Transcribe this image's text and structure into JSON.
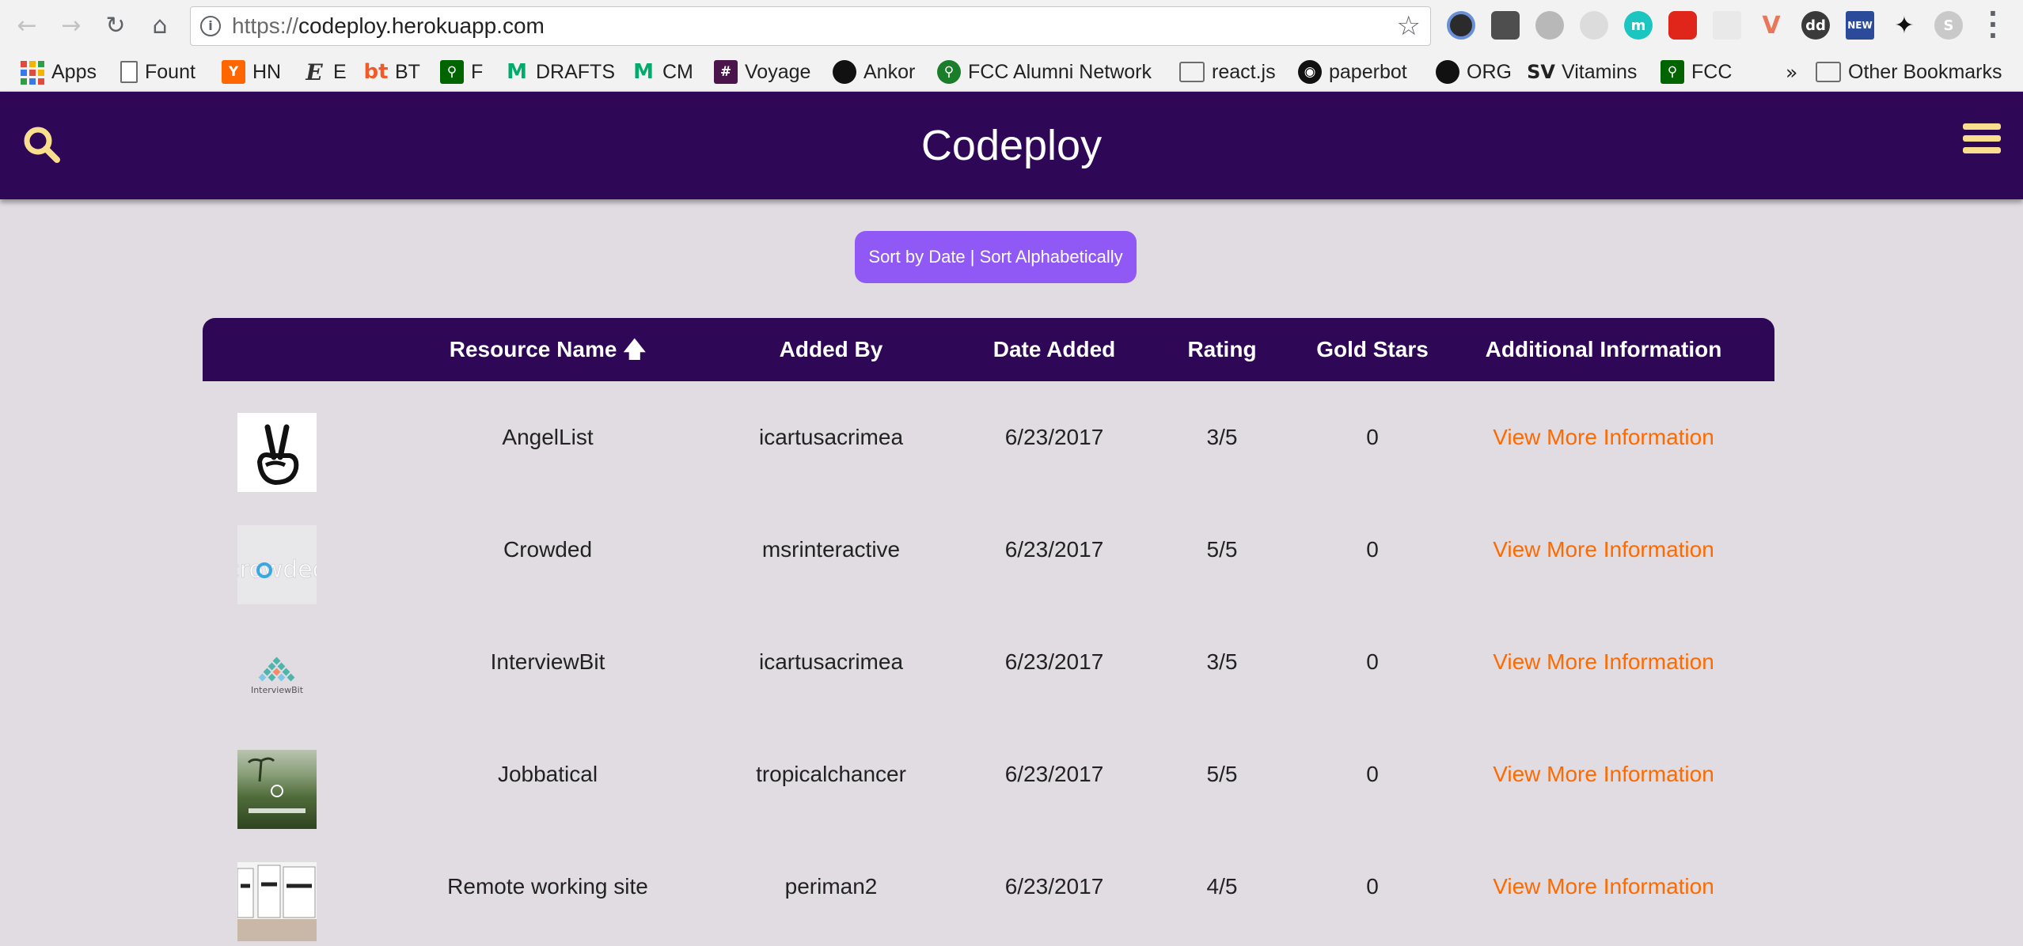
{
  "browser": {
    "url_scheme": "https://",
    "url_host": "codeploy.herokuapp.com",
    "bookmarks": [
      {
        "label": "Apps"
      },
      {
        "label": "Fount"
      },
      {
        "label": "HN"
      },
      {
        "label": "E"
      },
      {
        "label": "BT"
      },
      {
        "label": "F"
      },
      {
        "label": "DRAFTS"
      },
      {
        "label": "CM"
      },
      {
        "label": "Voyage"
      },
      {
        "label": "Ankor"
      },
      {
        "label": "FCC Alumni Network"
      },
      {
        "label": "react.js"
      },
      {
        "label": "paperbot"
      },
      {
        "label": "ORG"
      },
      {
        "label": "Vitamins"
      },
      {
        "label": "FCC"
      }
    ],
    "overflow_label": "»",
    "other_bookmarks": "Other Bookmarks"
  },
  "header": {
    "title": "Codeploy"
  },
  "sort": {
    "label": "Sort by Date | Sort Alphabetically"
  },
  "table": {
    "columns": [
      "Resource Name",
      "Added By",
      "Date Added",
      "Rating",
      "Gold Stars",
      "Additional Information"
    ],
    "sort_arrow": "🡅",
    "rows": [
      {
        "name": "AngelList",
        "added_by": "icartusacrimea",
        "date": "6/23/2017",
        "rating": "3/5",
        "gold_stars": "0",
        "info": "View More Information"
      },
      {
        "name": "Crowded",
        "added_by": "msrinteractive",
        "date": "6/23/2017",
        "rating": "5/5",
        "gold_stars": "0",
        "info": "View More Information"
      },
      {
        "name": "InterviewBit",
        "added_by": "icartusacrimea",
        "date": "6/23/2017",
        "rating": "3/5",
        "gold_stars": "0",
        "info": "View More Information"
      },
      {
        "name": "Jobbatical",
        "added_by": "tropicalchancer",
        "date": "6/23/2017",
        "rating": "5/5",
        "gold_stars": "0",
        "info": "View More Information"
      },
      {
        "name": "Remote working site",
        "added_by": "periman2",
        "date": "6/23/2017",
        "rating": "4/5",
        "gold_stars": "0",
        "info": "View More Information"
      }
    ]
  },
  "colors": {
    "header_bg": "#2e0757",
    "accent_yellow": "#f9df8d",
    "sort_button": "#9059f5",
    "link_orange": "#ff6a00",
    "page_bg": "#e0dce2"
  }
}
